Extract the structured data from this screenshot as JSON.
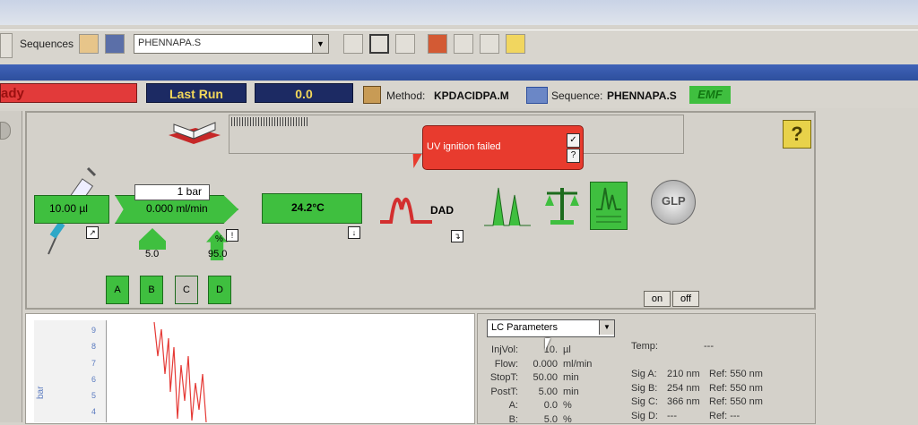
{
  "toolbar": {
    "sequences_label": "Sequences",
    "sequence_value": "PHENNAPA.S"
  },
  "status": {
    "state": "ady",
    "last_run_label": "Last Run",
    "last_run_value": "0.0",
    "method_label": "Method:",
    "method_value": "KPDACIDPA.M",
    "sequence_label": "Sequence:",
    "sequence_value": "PHENNAPA.S",
    "emf": "EMF"
  },
  "alert": {
    "message": "UV ignition failed",
    "check": "✓",
    "question": "?"
  },
  "help": "?",
  "instrument": {
    "injector": "10.00 µl",
    "pressure": "1 bar",
    "flow": "0.000 ml/min",
    "composition_b": "5.0",
    "composition_d": "95.0",
    "percent_symbol": "%",
    "column_temp": "24.2°C",
    "detector": "DAD",
    "glp": "GLP",
    "bottles": [
      "A",
      "B",
      "C",
      "D"
    ],
    "on": "on",
    "off": "off"
  },
  "plot": {
    "yticks": [
      "9",
      "8",
      "7",
      "6",
      "5",
      "4"
    ],
    "ylabel": "bar"
  },
  "params": {
    "select_value": "LC Parameters",
    "rows": [
      {
        "label": "InjVol:",
        "value": "10.",
        "unit": "µl"
      },
      {
        "label": "Flow:",
        "value": "0.000",
        "unit": "ml/min"
      },
      {
        "label": "StopT:",
        "value": "50.00",
        "unit": "min"
      },
      {
        "label": "PostT:",
        "value": "5.00",
        "unit": "min"
      },
      {
        "label": "A:",
        "value": "0.0",
        "unit": "%"
      },
      {
        "label": "B:",
        "value": "5.0",
        "unit": "%"
      }
    ],
    "temp_label": "Temp:",
    "temp_value": "---",
    "signals": [
      {
        "label": "Sig A:",
        "nm": "210 nm",
        "ref": "Ref: 550 nm"
      },
      {
        "label": "Sig B:",
        "nm": "254 nm",
        "ref": "Ref: 550 nm"
      },
      {
        "label": "Sig C:",
        "nm": "366 nm",
        "ref": "Ref: 550 nm"
      },
      {
        "label": "Sig D:",
        "nm": "---",
        "ref": "Ref:  ---"
      }
    ]
  }
}
